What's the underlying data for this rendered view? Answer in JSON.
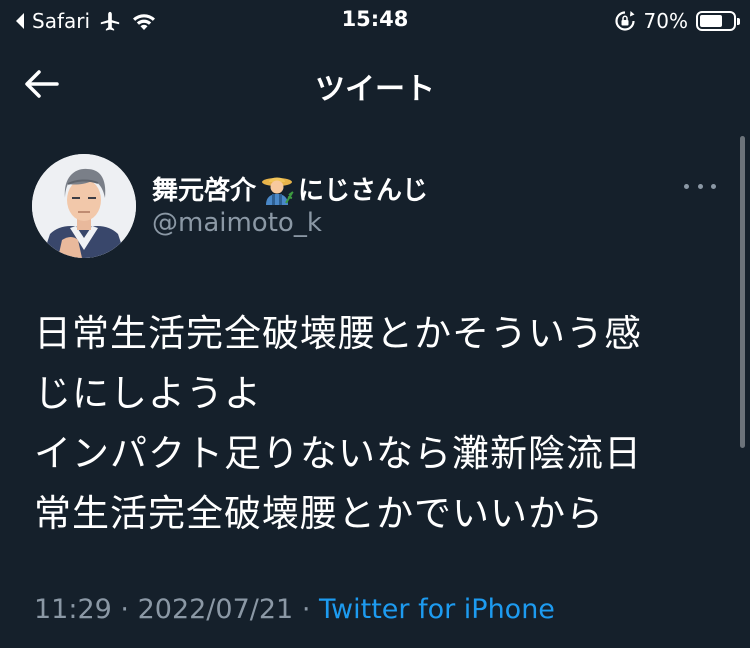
{
  "status_bar": {
    "back_app": "Safari",
    "time": "15:48",
    "battery_percent": "70%",
    "battery_level": 0.7,
    "icons": [
      "back-chevron-icon",
      "airplane-icon",
      "wifi-icon",
      "orientation-lock-icon",
      "battery-icon"
    ]
  },
  "header": {
    "title": "ツイート",
    "back_icon": "arrow-left-icon"
  },
  "tweet": {
    "display_name_part1": "舞元啓介",
    "display_name_emoji": "farmer-emoji",
    "display_name_part2": "にじさんじ",
    "username": "@maimoto_k",
    "more_icon": "more-options-icon",
    "text_lines": [
      "日常生活完全破壊腰とかそういう感",
      "じにしようよ",
      "インパクト足りないなら灘新陰流日",
      "常生活完全破壊腰とかでいいから"
    ],
    "time": "11:29",
    "separator1": "·",
    "date": "2022/07/21",
    "separator2": "·",
    "source": "Twitter for iPhone"
  },
  "colors": {
    "background": "#15202b",
    "text_primary": "#ffffff",
    "text_secondary": "#8b98a5",
    "accent": "#1d9bf0"
  }
}
